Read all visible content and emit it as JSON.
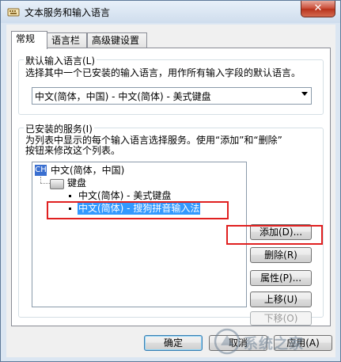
{
  "window": {
    "title": "文本服务和输入语言",
    "close_label": "✕"
  },
  "tabs": [
    {
      "label": "常规",
      "active": true
    },
    {
      "label": "语言栏",
      "active": false
    },
    {
      "label": "高级键设置",
      "active": false
    }
  ],
  "default_language": {
    "group_title": "默认输入语言(L)",
    "description": "选择其中一个已安装的输入语言，用作所有输入字段的默认语言。",
    "selected_value": "中文(简体，中国) - 中文(简体) - 美式键盘"
  },
  "installed_services": {
    "group_title": "已安装的服务(I)",
    "description_line1": "为列表中显示的每个输入语言选择服务。使用“添加”和“删除”",
    "description_line2": "按钮来修改这个列表。",
    "tree": {
      "language_badge": "CH",
      "language": "中文(简体，中国)",
      "category": "键盘",
      "items": [
        {
          "label": "中文(简体) - 美式键盘",
          "selected": false
        },
        {
          "label": "中文(简体) - 搜狗拼音输入法",
          "selected": true
        }
      ]
    },
    "buttons": {
      "add": "添加(D)...",
      "remove": "删除(R)",
      "properties": "属性(P)...",
      "move_up": "上移(U)",
      "move_down": "下移(O)"
    }
  },
  "footer": {
    "ok": "确定",
    "cancel": "取消",
    "apply": "应用(A)"
  },
  "watermark": {
    "text": "系统之家"
  },
  "colors": {
    "highlight_box": "#e02020",
    "selection": "#3399ff"
  }
}
